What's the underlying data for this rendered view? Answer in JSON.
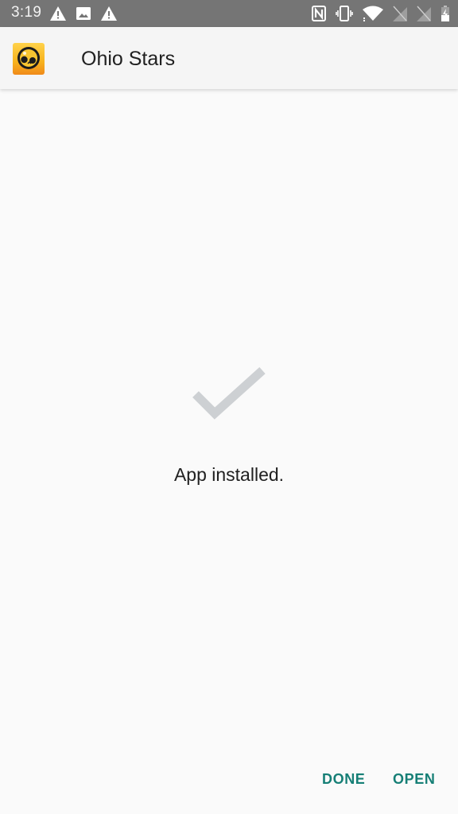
{
  "status_bar": {
    "time": "3:19",
    "left_icons": [
      "warning-icon",
      "image-icon",
      "warning-icon"
    ],
    "right_icons": [
      "nfc-icon",
      "vibrate-icon",
      "wifi-icon",
      "no-sim-icon",
      "no-sim-icon",
      "battery-charging-icon"
    ]
  },
  "app_bar": {
    "app_icon": "brawl-skull-app-icon",
    "title": "Ohio Stars"
  },
  "main": {
    "status_icon": "checkmark-icon",
    "message": "App installed."
  },
  "actions": {
    "done_label": "DONE",
    "open_label": "OPEN",
    "accent_color": "#167f76"
  }
}
